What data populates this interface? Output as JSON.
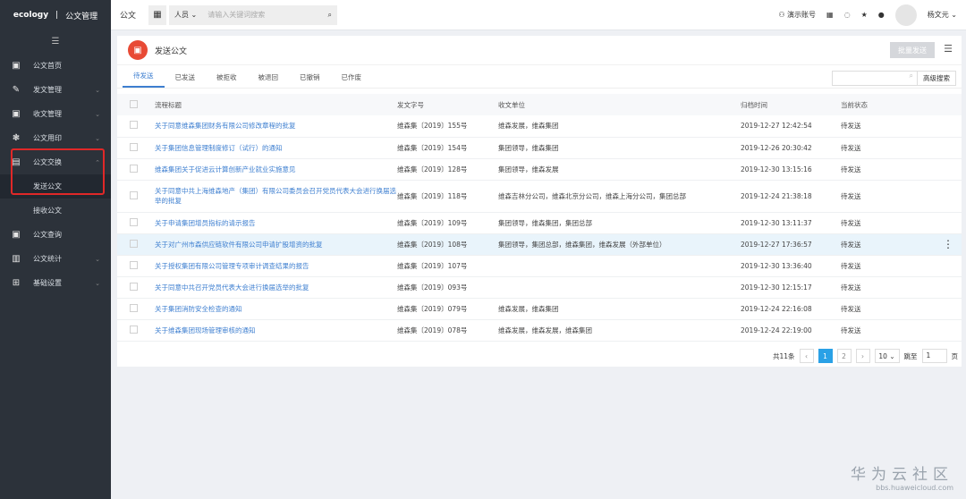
{
  "sidebar": {
    "brand": "ecology",
    "module": "公文管理",
    "toggle": "☰",
    "items": [
      {
        "label": "公文首页",
        "icon": "▣",
        "chev": ""
      },
      {
        "label": "发文管理",
        "icon": "✎",
        "chev": "⌄"
      },
      {
        "label": "收文管理",
        "icon": "▣",
        "chev": "⌄"
      },
      {
        "label": "公文用印",
        "icon": "❃",
        "chev": "⌄"
      },
      {
        "label": "公文交换",
        "icon": "▤",
        "chev": "⌃"
      },
      {
        "label": "发送公文",
        "icon": "",
        "chev": ""
      },
      {
        "label": "接收公文",
        "icon": "",
        "chev": ""
      },
      {
        "label": "公文查询",
        "icon": "▣",
        "chev": ""
      },
      {
        "label": "公文统计",
        "icon": "▥",
        "chev": "⌄"
      },
      {
        "label": "基础设置",
        "icon": "⊞",
        "chev": "⌄"
      }
    ]
  },
  "topbar": {
    "title": "公文",
    "search_scope": "人员 ⌄",
    "search_placeholder": "请输入关键词搜索",
    "demo_account": "演示账号",
    "user": "杨文元 ⌄"
  },
  "page": {
    "title": "发送公文",
    "create_button": "批量发送",
    "tabs": [
      "待发送",
      "已发送",
      "被拒收",
      "被退回",
      "已撤销",
      "已作废"
    ],
    "advanced_search": "高级搜索",
    "columns": [
      "流程标题",
      "发文字号",
      "收文单位",
      "归档时间",
      "当前状态"
    ],
    "rows": [
      {
        "title": "关于同意维森集团财务有限公司修改章程的批复",
        "no": "维森集〔2019〕155号",
        "unit": "维森发展，维森集团",
        "time": "2019-12-27 12:42:54",
        "status": "待发送"
      },
      {
        "title": "关于集团信息管理制度修订（试行）的通知",
        "no": "维森集〔2019〕154号",
        "unit": "集团领导，维森集团",
        "time": "2019-12-26 20:30:42",
        "status": "待发送"
      },
      {
        "title": "维森集团关于促进云计算创新产业就业实施意见",
        "no": "维森集〔2019〕128号",
        "unit": "集团领导，维森发展",
        "time": "2019-12-30 13:15:16",
        "status": "待发送"
      },
      {
        "title": "关于同意中共上海维森地产（集团）有限公司委员会召开党员代表大会进行换届选举的批复",
        "no": "维森集〔2019〕118号",
        "unit": "维森吉林分公司，维森北京分公司，维森上海分公司，集团总部",
        "time": "2019-12-24 21:38:18",
        "status": "待发送"
      },
      {
        "title": "关于申请集团增员指标的请示报告",
        "no": "维森集〔2019〕109号",
        "unit": "集团领导，维森集团，集团总部",
        "time": "2019-12-30 13:11:37",
        "status": "待发送"
      },
      {
        "title": "关于对广州市森供应链软件有限公司申请扩股增资的批复",
        "no": "维森集〔2019〕108号",
        "unit": "集团领导，集团总部，维森集团，维森发展（外部单位）",
        "time": "2019-12-27 17:36:57",
        "status": "待发送"
      },
      {
        "title": "关于授权集团有限公司管理专项审计调查结果的报告",
        "no": "维森集〔2019〕107号",
        "unit": "",
        "time": "2019-12-30 13:36:40",
        "status": "待发送"
      },
      {
        "title": "关于同意中共召开党员代表大会进行换届选举的批复",
        "no": "维森集〔2019〕093号",
        "unit": "",
        "time": "2019-12-30 12:15:17",
        "status": "待发送"
      },
      {
        "title": "关于集团消防安全检查的通知",
        "no": "维森集〔2019〕079号",
        "unit": "维森发展，维森集团",
        "time": "2019-12-24 22:16:08",
        "status": "待发送"
      },
      {
        "title": "关于维森集团现场管理审核的通知",
        "no": "维森集〔2019〕078号",
        "unit": "维森发展，维森发展，维森集团",
        "time": "2019-12-24 22:19:00",
        "status": "待发送"
      }
    ]
  },
  "pager": {
    "total": "共11条",
    "prev": "‹",
    "pages": [
      "1",
      "2"
    ],
    "next": "›",
    "size": "10 ⌄",
    "goto": "跳至",
    "goto_value": "1",
    "page_unit": "页"
  },
  "watermark": {
    "line1": "华为云社区",
    "line2": "bbs.huaweicloud.com"
  }
}
